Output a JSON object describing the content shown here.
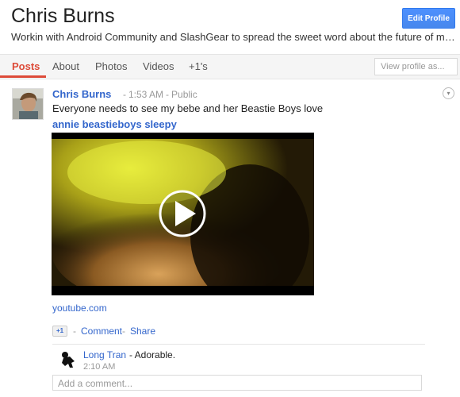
{
  "profile": {
    "name": "Chris Burns",
    "tagline": "Workin with Android Community and SlashGear to spread the sweet word about the future of mobile c...",
    "edit_button": "Edit Profile"
  },
  "tabs": [
    {
      "label": "Posts",
      "active": true
    },
    {
      "label": "About",
      "active": false
    },
    {
      "label": "Photos",
      "active": false
    },
    {
      "label": "Videos",
      "active": false
    },
    {
      "label": "+1's",
      "active": false
    }
  ],
  "view_profile_as": {
    "placeholder": "View profile as..."
  },
  "post": {
    "author": "Chris Burns",
    "time": "1:53 AM",
    "visibility": "Public",
    "text": "Everyone needs to see my bebe and her Beastie Boys love",
    "video_title": "annie beastieboys sleepy",
    "source": "youtube.com",
    "plusone_label": "+1",
    "comment_label": "Comment",
    "share_label": "Share"
  },
  "comment": {
    "author": "Long Tran",
    "text": "- Adorable.",
    "time": "2:10 AM"
  },
  "comment_input": {
    "placeholder": "Add a comment..."
  },
  "colors": {
    "accent_red": "#dd4b39",
    "link_blue": "#3366cc",
    "button_blue": "#4d90fe"
  }
}
